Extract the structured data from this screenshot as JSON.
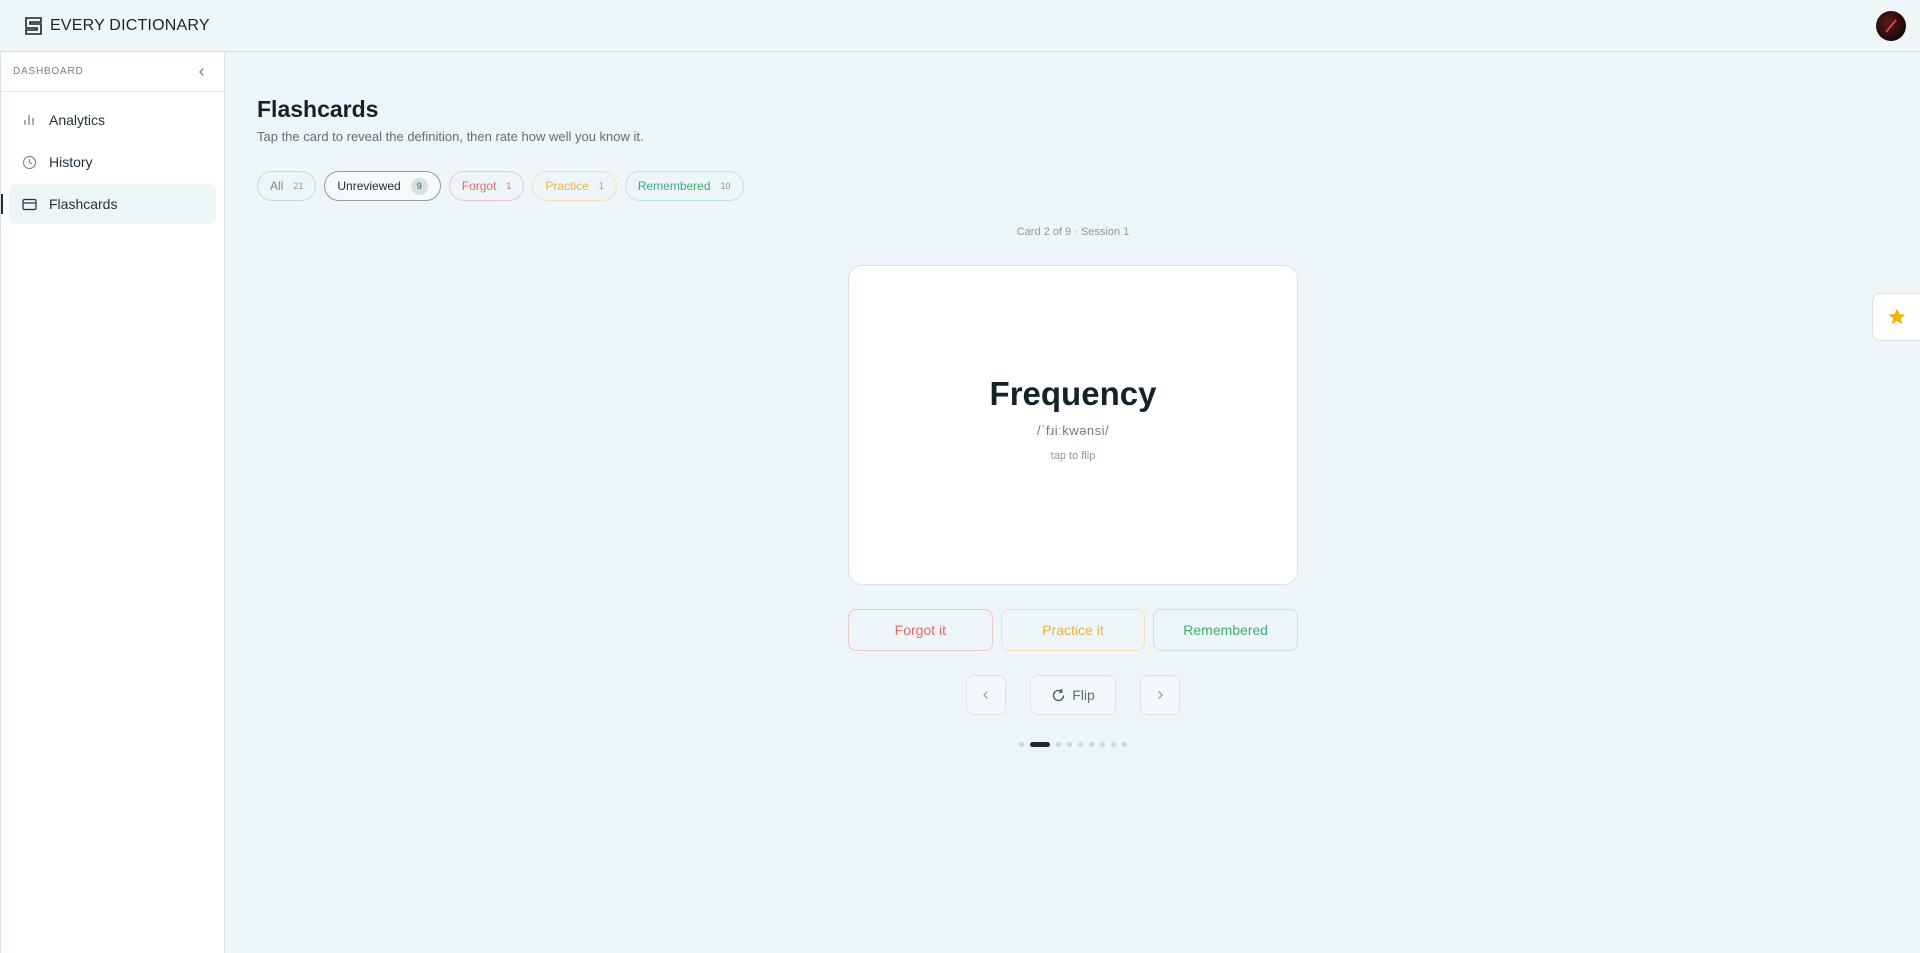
{
  "header": {
    "brand": "EVERY DICTIONARY"
  },
  "sidebar": {
    "section_label": "DASHBOARD",
    "items": [
      {
        "label": "Analytics",
        "icon": "bar-chart-icon"
      },
      {
        "label": "History",
        "icon": "clock-icon"
      },
      {
        "label": "Flashcards",
        "icon": "card-icon",
        "active": true
      }
    ]
  },
  "main": {
    "title": "Flashcards",
    "subtitle": "Tap the card to reveal the definition, then rate how well you know it.",
    "filters": [
      {
        "label": "All",
        "count": "21"
      },
      {
        "label": "Unreviewed",
        "count": "9",
        "selected": true
      },
      {
        "label": "Forgot",
        "count": "1"
      },
      {
        "label": "Practice",
        "count": "1"
      },
      {
        "label": "Remembered",
        "count": "10"
      }
    ],
    "progress": "Card 2 of 9 · Session 1",
    "card": {
      "word": "Frequency",
      "phonetic": "/ˈfɹiːkwənsi/",
      "hint": "tap to flip"
    },
    "ratings": {
      "forgot": "Forgot it",
      "practice": "Practice it",
      "remembered": "Remembered"
    },
    "controls": {
      "flip": "Flip"
    },
    "pagination": {
      "total": 9,
      "current": 2
    }
  },
  "colors": {
    "forgot": "#e06a6a",
    "practice": "#eeb043",
    "remembered": "#3fae74",
    "star": "#f5b400"
  }
}
